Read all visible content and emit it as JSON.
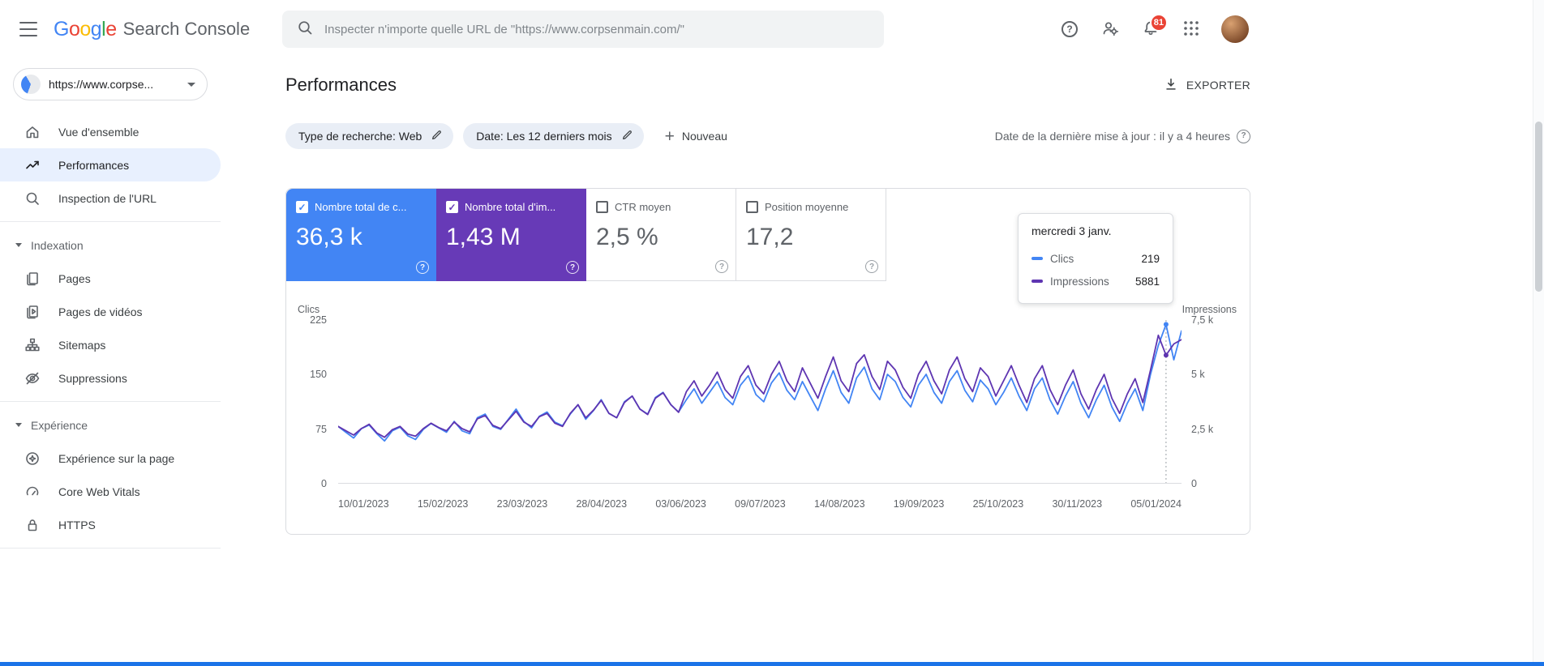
{
  "header": {
    "logo": {
      "letters": [
        [
          "G",
          "#4285F4"
        ],
        [
          "o",
          "#EA4335"
        ],
        [
          "o",
          "#FBBC04"
        ],
        [
          "g",
          "#4285F4"
        ],
        [
          "l",
          "#34A853"
        ],
        [
          "e",
          "#EA4335"
        ]
      ],
      "suffix": "Search Console"
    },
    "search": {
      "placeholder": "Inspecter n'importe quelle URL de \"https://www.corpsenmain.com/\""
    },
    "notifications_badge": "81",
    "help_glyph": "?"
  },
  "sidebar": {
    "property_label": "https://www.corpse...",
    "groups": [
      {
        "items": [
          {
            "label": "Vue d'ensemble"
          },
          {
            "label": "Performances"
          },
          {
            "label": "Inspection de l'URL"
          }
        ]
      },
      {
        "header": "Indexation",
        "items": [
          {
            "label": "Pages"
          },
          {
            "label": "Pages de vidéos"
          },
          {
            "label": "Sitemaps"
          },
          {
            "label": "Suppressions"
          }
        ]
      },
      {
        "header": "Expérience",
        "items": [
          {
            "label": "Expérience sur la page"
          },
          {
            "label": "Core Web Vitals"
          },
          {
            "label": "HTTPS"
          }
        ]
      }
    ]
  },
  "main": {
    "title": "Performances",
    "export_label": "EXPORTER",
    "filters": {
      "search_type": "Type de recherche: Web",
      "date": "Date: Les 12 derniers mois",
      "plus_glyph": "+",
      "new_label": "Nouveau"
    },
    "last_update": "Date de la dernière mise à jour : il y a 4 heures",
    "help_glyph": "?",
    "check_glyph": "✓",
    "metrics": [
      {
        "label": "Nombre total de c...",
        "value": "36,3 k",
        "checked": true,
        "bg": "#4285F4",
        "fg": "#ffffff"
      },
      {
        "label": "Nombre total d'im...",
        "value": "1,43 M",
        "checked": true,
        "bg": "#673AB7",
        "fg": "#ffffff"
      },
      {
        "label": "CTR moyen",
        "value": "2,5 %",
        "checked": false
      },
      {
        "label": "Position moyenne",
        "value": "17,2",
        "checked": false
      }
    ],
    "tooltip": {
      "title": "mercredi 3 janv.",
      "rows": [
        {
          "label": "Clics",
          "value": "219",
          "color": "#4285F4"
        },
        {
          "label": "Impressions",
          "value": "5881",
          "color": "#5E35B1"
        }
      ]
    }
  },
  "chart_data": {
    "type": "line",
    "title": "Performances - Clics et Impressions (12 derniers mois)",
    "x_tick_labels": [
      "10/01/2023",
      "15/02/2023",
      "23/03/2023",
      "28/04/2023",
      "03/06/2023",
      "09/07/2023",
      "14/08/2023",
      "19/09/2023",
      "25/10/2023",
      "30/11/2023",
      "05/01/2024"
    ],
    "left_axis": {
      "label": "Clics",
      "ticks": [
        "225",
        "150",
        "75",
        "0"
      ],
      "max": 225
    },
    "right_axis": {
      "label": "Impressions",
      "ticks": [
        "7,5 k",
        "5 k",
        "2,5 k",
        "0"
      ],
      "max": 7500
    },
    "grid": false,
    "legend_position": "tooltip",
    "hover_index": 107,
    "series": [
      {
        "name": "Clics",
        "axis": "left",
        "color": "#4285F4",
        "values": [
          78,
          70,
          62,
          75,
          80,
          68,
          58,
          72,
          77,
          65,
          60,
          74,
          82,
          76,
          70,
          85,
          72,
          68,
          90,
          95,
          78,
          74,
          88,
          102,
          85,
          76,
          92,
          98,
          84,
          79,
          95,
          108,
          88,
          100,
          115,
          96,
          90,
          112,
          120,
          102,
          95,
          118,
          125,
          108,
          98,
          115,
          130,
          110,
          125,
          140,
          118,
          108,
          135,
          148,
          122,
          112,
          138,
          152,
          128,
          115,
          140,
          120,
          100,
          130,
          155,
          125,
          110,
          145,
          160,
          130,
          115,
          150,
          140,
          118,
          105,
          135,
          150,
          125,
          110,
          140,
          155,
          128,
          112,
          142,
          130,
          108,
          125,
          145,
          120,
          100,
          130,
          145,
          115,
          95,
          120,
          140,
          110,
          90,
          115,
          135,
          105,
          85,
          110,
          130,
          100,
          150,
          190,
          219,
          170,
          210
        ]
      },
      {
        "name": "Impressions",
        "axis": "right",
        "color": "#5E35B1",
        "values": [
          2600,
          2400,
          2200,
          2500,
          2700,
          2300,
          2100,
          2450,
          2600,
          2250,
          2150,
          2500,
          2750,
          2550,
          2400,
          2800,
          2500,
          2350,
          2950,
          3100,
          2650,
          2500,
          2900,
          3300,
          2800,
          2600,
          3050,
          3200,
          2750,
          2600,
          3200,
          3600,
          3000,
          3350,
          3800,
          3200,
          3000,
          3700,
          4000,
          3400,
          3150,
          3900,
          4150,
          3600,
          3250,
          4200,
          4700,
          4000,
          4500,
          5100,
          4300,
          3900,
          4900,
          5400,
          4500,
          4100,
          5000,
          5600,
          4700,
          4200,
          5300,
          4600,
          3900,
          4900,
          5800,
          4700,
          4200,
          5500,
          5900,
          4900,
          4300,
          5600,
          5200,
          4400,
          3900,
          5000,
          5600,
          4700,
          4100,
          5200,
          5800,
          4800,
          4200,
          5300,
          4900,
          4000,
          4700,
          5400,
          4500,
          3700,
          4800,
          5400,
          4300,
          3600,
          4500,
          5200,
          4100,
          3400,
          4300,
          5000,
          3900,
          3200,
          4100,
          4800,
          3700,
          5200,
          6800,
          5881,
          6400,
          6600
        ]
      }
    ]
  }
}
